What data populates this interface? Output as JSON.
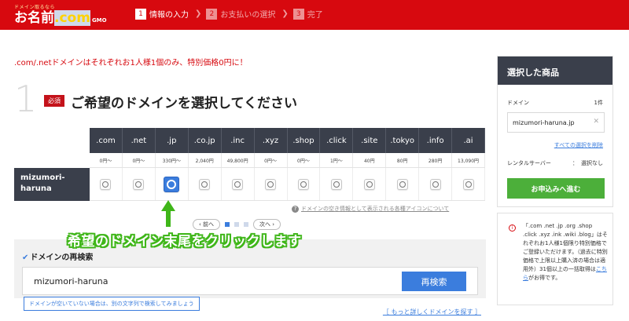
{
  "header": {
    "logo_small": "ドメイン取るなら",
    "logo_main": "お名前",
    "logo_dot": ".com",
    "logo_gmo": "GMO",
    "steps": [
      {
        "num": "1",
        "label": "情報の入力"
      },
      {
        "num": "2",
        "label": "お支払いの選択"
      },
      {
        "num": "3",
        "label": "完了"
      }
    ]
  },
  "notice": ".com/.netドメインはそれぞれお1人様1個のみ、特別価格0円に！",
  "heading": {
    "number": "1",
    "required_badge": "必須",
    "title": "ご希望のドメインを選択してください"
  },
  "tld_table": {
    "row_label": "mizumori-haruna",
    "tlds": [
      ".com",
      ".net",
      ".jp",
      ".co.jp",
      ".inc",
      ".xyz",
      ".shop",
      ".click",
      ".site",
      ".tokyo",
      ".info",
      ".ai"
    ],
    "prices": [
      "0円〜",
      "0円〜",
      "330円〜",
      "2,040円",
      "49,800円",
      "0円〜",
      "0円〜",
      "1円〜",
      "40円",
      "80円",
      "280円",
      "13,090円"
    ],
    "selected_index": 2
  },
  "help_link": "ドメインの空き情報として表示される各種アイコンについて",
  "pager": {
    "prev": "前へ",
    "next": "次へ"
  },
  "annotation": "希望のドメイン末尾をクリックします",
  "research": {
    "title": "ドメインの再検索",
    "value": "mizumori-haruna",
    "button": "再検索",
    "tooltip": "ドメインが空いていない場合は、別の文字列で検索してみましょう",
    "more_link": "［ もっと詳しくドメインを探す ］"
  },
  "side": {
    "title": "選択した商品",
    "domain_label": "ドメイン",
    "domain_count": "1件",
    "domain_value": "mizumori-haruna.jp",
    "clear_link": "すべての選択を削除",
    "rental_label": "レンタルサーバー",
    "rental_colon": "：",
    "rental_value": "選択なし",
    "order_button": "お申込みへ進む"
  },
  "info": {
    "text": "「.com .net .jp .org .shop .click .xyz .ink .wiki .blog」はそれぞれお1人様1個限り特別価格でご登録いただけます。（過去に特別価格で上限以上購入済の場合は適用外）31個以上の一括取得は",
    "link": "こちら",
    "tail": "がお得です。"
  },
  "colors": {
    "brand_red": "#d7090f",
    "dark_header": "#3a3f4b",
    "accent_blue": "#3b7ddd",
    "order_green": "#4caf3a",
    "annotation_green": "#3fb619"
  }
}
